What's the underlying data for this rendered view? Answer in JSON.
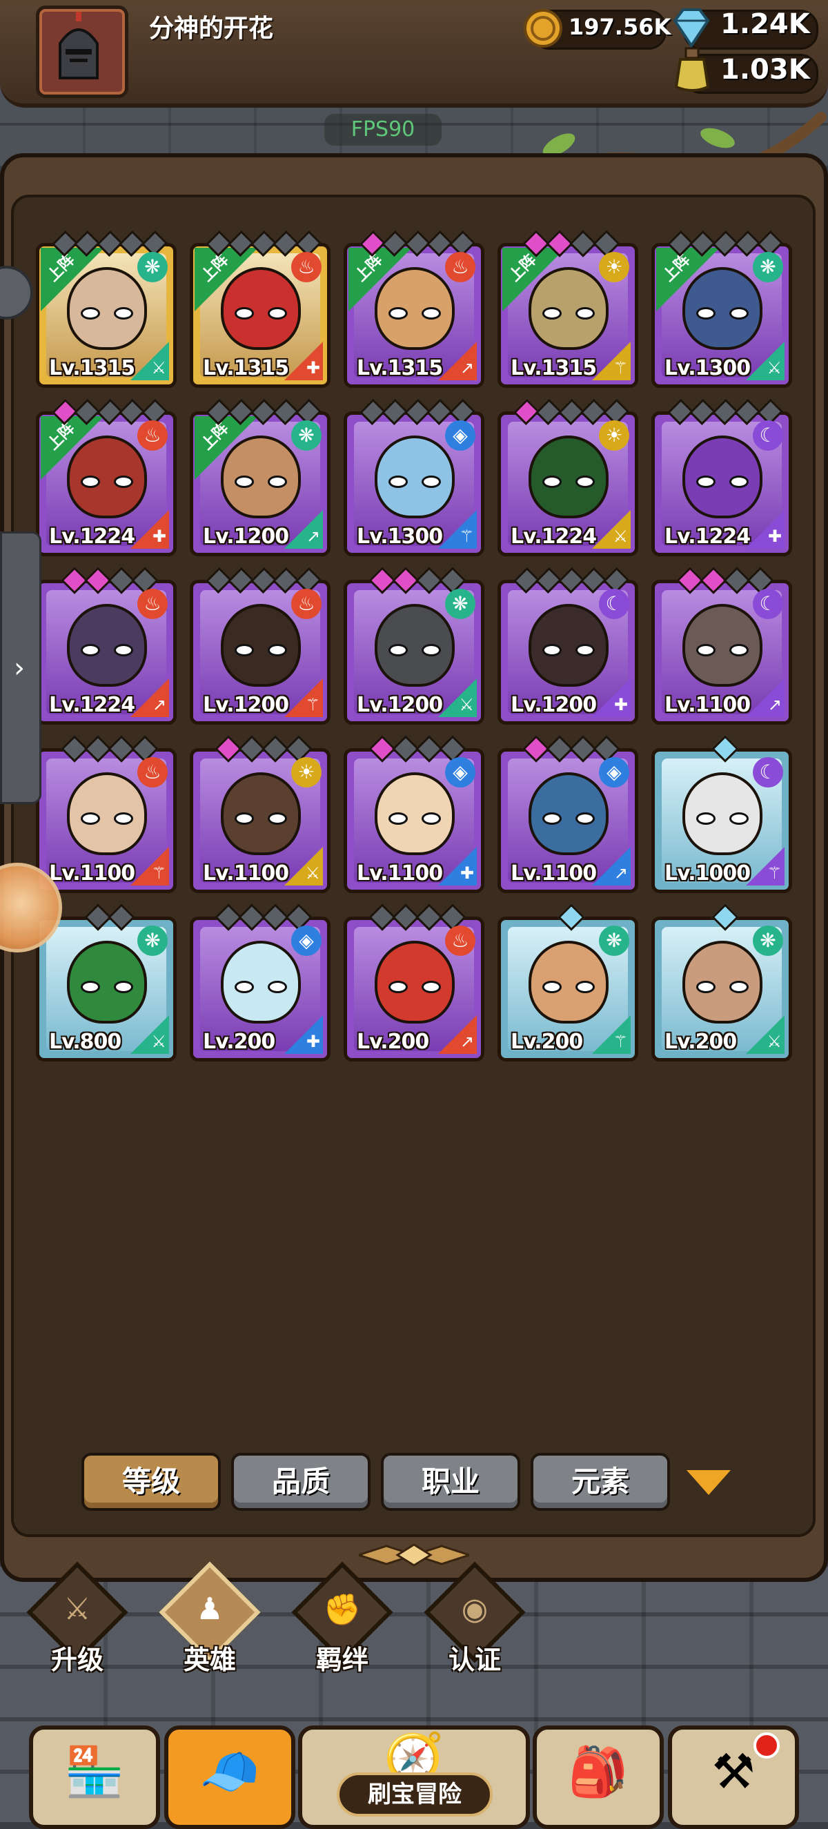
{
  "header": {
    "player_name": "分神的开花",
    "gold": "197.56K",
    "gems": "1.24K",
    "potion": "1.03K",
    "fps": "FPS90"
  },
  "colors": {
    "fire": "#e24a2f",
    "wind": "#27b48a",
    "water": "#2f7fe0",
    "light": "#d9a91c",
    "dark": "#8a4bd6",
    "deploy_ribbon": "#25a04a"
  },
  "heroes": [
    {
      "level": "Lv.1315",
      "rarity": "gold",
      "element": "wind",
      "element_icon": "❋",
      "deployed": true,
      "skin": "#d7b89a",
      "stars": [
        "g",
        "g",
        "g",
        "g",
        "g"
      ]
    },
    {
      "level": "Lv.1315",
      "rarity": "gold",
      "element": "fire",
      "element_icon": "♨",
      "deployed": true,
      "skin": "#c9302e",
      "stars": [
        "g",
        "g",
        "g",
        "g",
        "g"
      ]
    },
    {
      "level": "Lv.1315",
      "rarity": "purple",
      "element": "fire",
      "element_icon": "♨",
      "deployed": true,
      "skin": "#d9a16a",
      "stars": [
        "p",
        "g",
        "g",
        "g",
        "g"
      ]
    },
    {
      "level": "Lv.1315",
      "rarity": "purple",
      "element": "light",
      "element_icon": "☀",
      "deployed": true,
      "skin": "#b9a16b",
      "stars": [
        "p",
        "p",
        "g",
        "g"
      ]
    },
    {
      "level": "Lv.1300",
      "rarity": "purple",
      "element": "wind",
      "element_icon": "❋",
      "deployed": true,
      "skin": "#3f5a8f",
      "stars": [
        "g",
        "g",
        "g",
        "g",
        "g"
      ]
    },
    {
      "level": "Lv.1224",
      "rarity": "purple",
      "element": "fire",
      "element_icon": "♨",
      "deployed": true,
      "skin": "#a8362c",
      "stars": [
        "p",
        "g",
        "g",
        "g",
        "g"
      ]
    },
    {
      "level": "Lv.1200",
      "rarity": "purple",
      "element": "wind",
      "element_icon": "❋",
      "deployed": true,
      "skin": "#c58f66",
      "stars": [
        "g",
        "g",
        "g",
        "g",
        "g"
      ]
    },
    {
      "level": "Lv.1300",
      "rarity": "purple",
      "element": "water",
      "element_icon": "◈",
      "deployed": false,
      "skin": "#8fc3e6",
      "stars": [
        "g",
        "g",
        "g",
        "g",
        "g"
      ]
    },
    {
      "level": "Lv.1224",
      "rarity": "purple",
      "element": "light",
      "element_icon": "☀",
      "deployed": false,
      "skin": "#255a2a",
      "stars": [
        "p",
        "g",
        "g",
        "g",
        "g"
      ]
    },
    {
      "level": "Lv.1224",
      "rarity": "purple",
      "element": "dark",
      "element_icon": "☾",
      "deployed": false,
      "skin": "#7a3db3",
      "stars": [
        "g",
        "g",
        "g",
        "g",
        "g"
      ]
    },
    {
      "level": "Lv.1224",
      "rarity": "purple",
      "element": "fire",
      "element_icon": "♨",
      "deployed": false,
      "skin": "#4c3b5e",
      "stars": [
        "p",
        "p",
        "g",
        "g"
      ]
    },
    {
      "level": "Lv.1200",
      "rarity": "purple",
      "element": "fire",
      "element_icon": "♨",
      "deployed": false,
      "skin": "#3a2a22",
      "stars": [
        "g",
        "g",
        "g",
        "g",
        "g"
      ]
    },
    {
      "level": "Lv.1200",
      "rarity": "purple",
      "element": "wind",
      "element_icon": "❋",
      "deployed": false,
      "skin": "#4a4c50",
      "stars": [
        "p",
        "p",
        "g",
        "g"
      ]
    },
    {
      "level": "Lv.1200",
      "rarity": "purple",
      "element": "dark",
      "element_icon": "☾",
      "deployed": false,
      "skin": "#3b2b2b",
      "stars": [
        "g",
        "g",
        "g",
        "g",
        "g"
      ]
    },
    {
      "level": "Lv.1100",
      "rarity": "purple",
      "element": "dark",
      "element_icon": "☾",
      "deployed": false,
      "skin": "#6b5a55",
      "stars": [
        "p",
        "p",
        "g",
        "g"
      ]
    },
    {
      "level": "Lv.1100",
      "rarity": "purple",
      "element": "fire",
      "element_icon": "♨",
      "deployed": false,
      "skin": "#e3c4a6",
      "stars": [
        "g",
        "g",
        "g",
        "g"
      ]
    },
    {
      "level": "Lv.1100",
      "rarity": "purple",
      "element": "light",
      "element_icon": "☀",
      "deployed": false,
      "skin": "#5b4030",
      "stars": [
        "p",
        "g",
        "g",
        "g"
      ]
    },
    {
      "level": "Lv.1100",
      "rarity": "purple",
      "element": "water",
      "element_icon": "◈",
      "deployed": false,
      "skin": "#f0d5b5",
      "stars": [
        "p",
        "g",
        "g",
        "g"
      ]
    },
    {
      "level": "Lv.1100",
      "rarity": "purple",
      "element": "water",
      "element_icon": "◈",
      "deployed": false,
      "skin": "#3b6da0",
      "stars": [
        "p",
        "g",
        "g",
        "g"
      ]
    },
    {
      "level": "Lv.1000",
      "rarity": "blue",
      "element": "dark",
      "element_icon": "☾",
      "deployed": false,
      "skin": "#e6e6e6",
      "stars": [
        "b"
      ]
    },
    {
      "level": "Lv.800",
      "rarity": "blue",
      "element": "wind",
      "element_icon": "❋",
      "deployed": false,
      "skin": "#2f8a3d",
      "stars": [
        "g",
        "g"
      ]
    },
    {
      "level": "Lv.200",
      "rarity": "purple",
      "element": "water",
      "element_icon": "◈",
      "deployed": false,
      "skin": "#c8e8f2",
      "stars": [
        "g",
        "g",
        "g",
        "g"
      ]
    },
    {
      "level": "Lv.200",
      "rarity": "purple",
      "element": "fire",
      "element_icon": "♨",
      "deployed": false,
      "skin": "#d23a2e",
      "stars": [
        "g",
        "g",
        "g",
        "g"
      ]
    },
    {
      "level": "Lv.200",
      "rarity": "blue",
      "element": "wind",
      "element_icon": "❋",
      "deployed": false,
      "skin": "#d9a072",
      "stars": [
        "b"
      ]
    },
    {
      "level": "Lv.200",
      "rarity": "blue",
      "element": "wind",
      "element_icon": "❋",
      "deployed": false,
      "skin": "#c89c7d",
      "stars": [
        "b"
      ]
    }
  ],
  "deploy_label": "上阵",
  "sort": {
    "level": "等级",
    "quality": "品质",
    "job": "职业",
    "element": "元素"
  },
  "subnav": {
    "upgrade": "升级",
    "hero": "英雄",
    "bond": "羁绊",
    "certify": "认证"
  },
  "bottom_nav": {
    "treasure": "刷宝冒险",
    "icons": [
      "shop-icon",
      "hero-icon",
      "treasure-map-icon",
      "backpack-icon",
      "forge-icon"
    ]
  }
}
